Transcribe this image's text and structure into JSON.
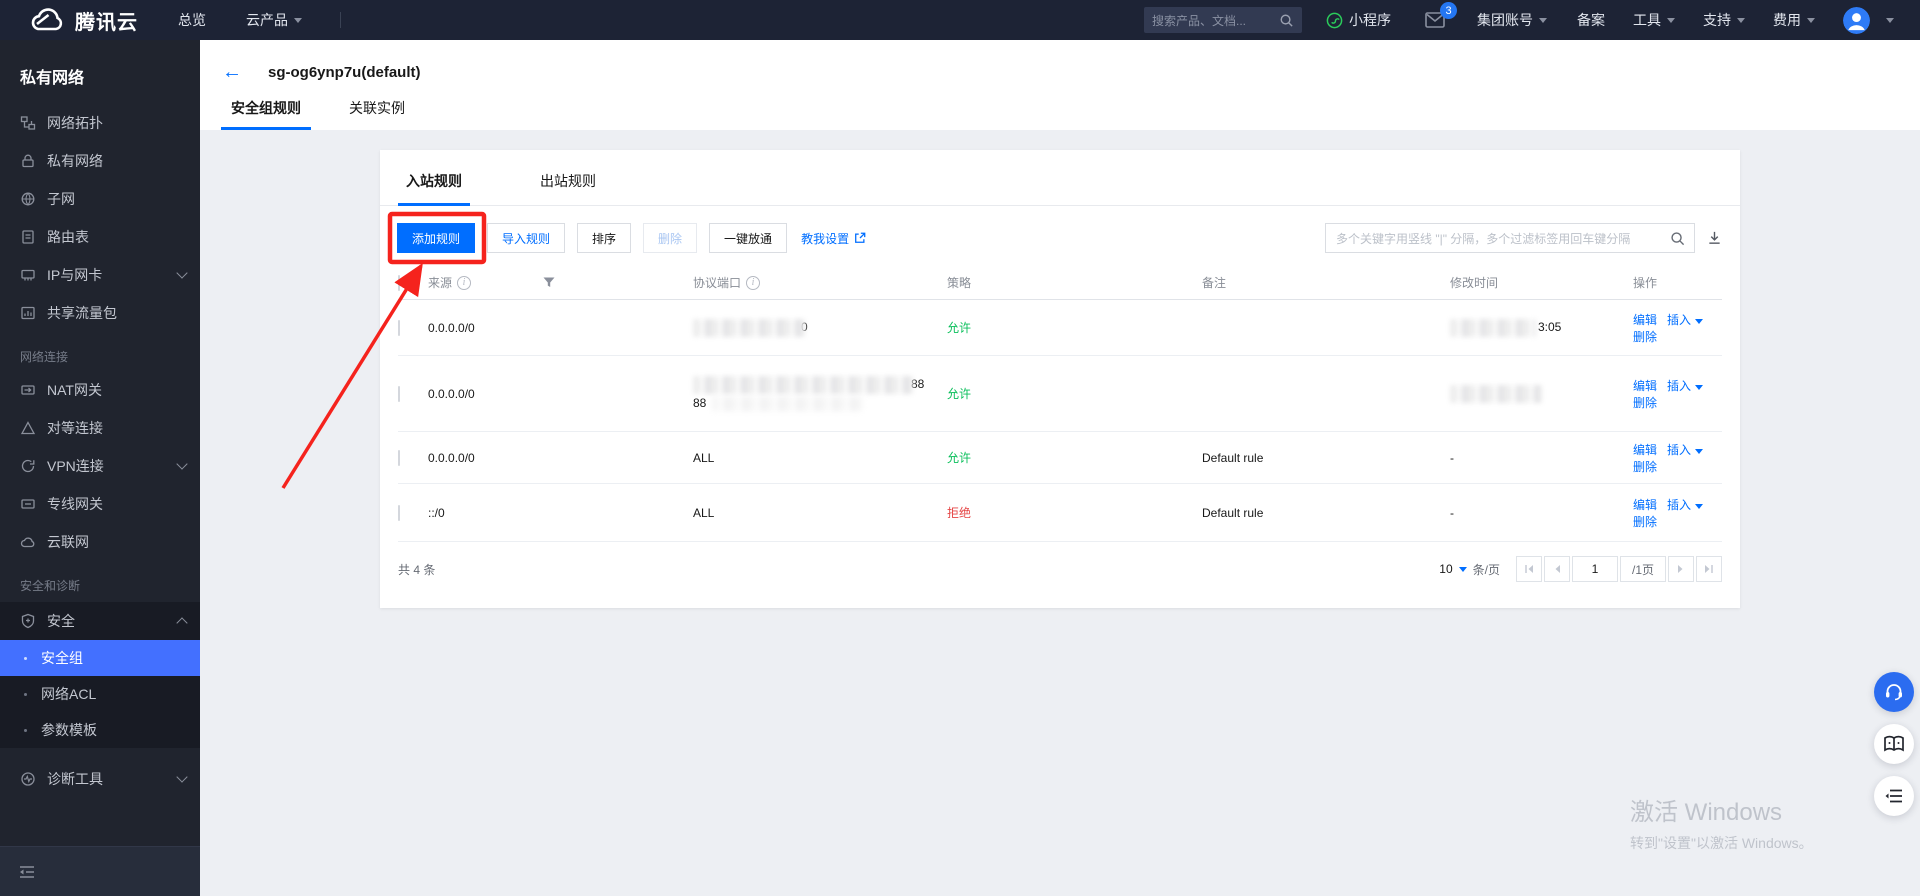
{
  "colors": {
    "accent": "#006eff",
    "allow_green": "#0abf5b",
    "deny_red": "#e54545",
    "annotation_red": "#f5231d",
    "sidebar_selected": "#4370ff"
  },
  "topnav": {
    "logo_text": "腾讯云",
    "overview": "总览",
    "products": "云产品",
    "search_placeholder": "搜索产品、文档...",
    "miniprogram": "小程序",
    "mail_badge": "3",
    "group_account": "集团账号",
    "beian": "备案",
    "tools": "工具",
    "support": "支持",
    "billing": "费用"
  },
  "sidebar": {
    "title": "私有网络",
    "items": [
      {
        "label": "网络拓扑"
      },
      {
        "label": "私有网络"
      },
      {
        "label": "子网"
      },
      {
        "label": "路由表"
      },
      {
        "label": "IP与网卡"
      },
      {
        "label": "共享流量包"
      }
    ],
    "section_network": "网络连接",
    "items_network": [
      {
        "label": "NAT网关"
      },
      {
        "label": "对等连接"
      },
      {
        "label": "VPN连接"
      },
      {
        "label": "专线网关"
      },
      {
        "label": "云联网"
      }
    ],
    "section_security": "安全和诊断",
    "security_parent": "安全",
    "security_children": [
      {
        "label": "安全组",
        "selected": true
      },
      {
        "label": "网络ACL"
      },
      {
        "label": "参数模板"
      }
    ],
    "diagnostics": "诊断工具"
  },
  "page": {
    "title": "sg-og6ynp7u(default)",
    "tab_rules": "安全组规则",
    "tab_instances": "关联实例"
  },
  "card": {
    "tab_inbound": "入站规则",
    "tab_outbound": "出站规则",
    "toolbar": {
      "add": "添加规则",
      "import": "导入规则",
      "sort": "排序",
      "delete": "删除",
      "open_all": "一键放通",
      "teach": "教我设置",
      "search_placeholder": "多个关键字用竖线 \"|\" 分隔，多个过滤标签用回车键分隔"
    },
    "table": {
      "headers": {
        "source": "来源",
        "protocol": "协议端口",
        "policy": "策略",
        "notes": "备注",
        "modified": "修改时间",
        "action": "操作"
      },
      "rows": [
        {
          "source": "0.0.0.0/0",
          "protocol_visible": "0",
          "policy": "允许",
          "notes": "",
          "time_visible": "3:05"
        },
        {
          "source": "0.0.0.0/0",
          "protocol_visible": "88",
          "protocol_line2": "88",
          "policy": "允许",
          "notes": "",
          "time_visible": ""
        },
        {
          "source": "0.0.0.0/0",
          "protocol": "ALL",
          "policy": "允许",
          "notes": "Default rule",
          "time": "-"
        },
        {
          "source": "::/0",
          "protocol": "ALL",
          "policy": "拒绝",
          "notes": "Default rule",
          "time": "-"
        }
      ],
      "row_actions": {
        "edit": "编辑",
        "insert": "插入",
        "delete": "删除"
      }
    },
    "pagination": {
      "total": "共 4 条",
      "page_size": "10",
      "unit": "条/页",
      "page": "1",
      "total_pages": "/1页"
    }
  },
  "watermark": {
    "line1": "激活 Windows",
    "line2": "转到\"设置\"以激活 Windows。"
  }
}
